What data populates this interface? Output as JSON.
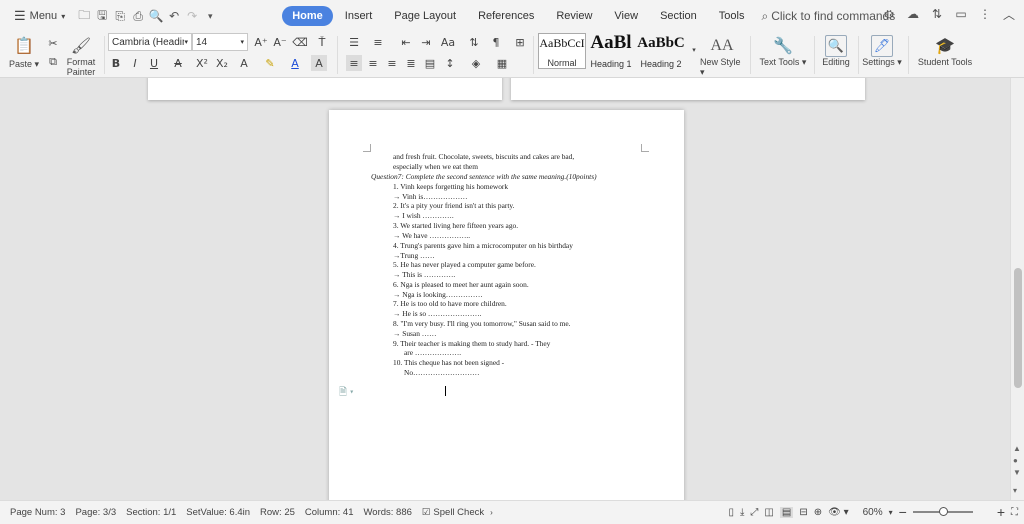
{
  "menubar": {
    "menu_label": "Menu",
    "tabs": [
      "Home",
      "Insert",
      "Page Layout",
      "References",
      "Review",
      "View",
      "Section",
      "Tools"
    ],
    "active_tab": "Home",
    "command_search_placeholder": "Click to find commands"
  },
  "ribbon": {
    "paste_label": "Paste",
    "format_painter_label": "Format Painter",
    "font_name": "Cambria (Headings",
    "font_size": "14",
    "styles": [
      {
        "sample": "AaBbCcI",
        "label": "Normal"
      },
      {
        "sample": "AaBl",
        "label": "Heading 1"
      },
      {
        "sample": "AaBbC",
        "label": "Heading 2"
      }
    ],
    "new_style_label": "New Style",
    "text_tools_label": "Text Tools",
    "editing_label": "Editing",
    "settings_label": "Settings",
    "student_tools_label": "Student Tools"
  },
  "document": {
    "lines": [
      "and fresh fruit. Chocolate, sweets, biscuits and cakes are bad,",
      "especially when we eat them",
      "Question7: Complete the second sentence with the same meaning.(10points)",
      "1.  Vinh keeps forgetting his homework",
      "→ Vinh is………………",
      "2.  It's a pity your friend isn't at this party.",
      "→ I wish ………….",
      "3.  We started living here fifteen years ago.",
      "→ We have ……………..",
      "4.  Trung's parents gave him a microcomputer on his birthday",
      "→Trung ……",
      "5.  He has never played a computer game before.",
      "→ This is ………….",
      "6.  Nga is pleased to meet her aunt again soon.",
      "→ Nga is looking……………",
      "7.  He is too old to have more children.",
      "→ He is so ………………….",
      "8.  \"I'm very busy. I'll ring you tomorrow,\" Susan said to me.",
      "→ Susan ……",
      "9.  Their   teacher   is   making   them   to   study   hard.         -  They",
      "are ……………….",
      "10.     This cheque has not been signed                    -",
      "No………………………"
    ]
  },
  "status": {
    "page_num": "Page Num: 3",
    "page": "Page: 3/3",
    "section": "Section: 1/1",
    "set_value": "SetValue: 6.4in",
    "row": "Row: 25",
    "column": "Column: 41",
    "words": "Words: 886",
    "spell_check": "Spell Check",
    "zoom": "60%"
  }
}
